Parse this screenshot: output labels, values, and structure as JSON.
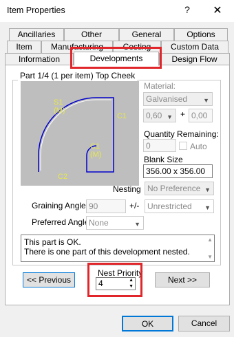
{
  "window": {
    "title": "Item Properties",
    "help": "?",
    "close": "✕"
  },
  "tabs_row1": [
    "Ancillaries",
    "Other",
    "General",
    "Options"
  ],
  "tabs_row2": [
    "Item",
    "Manufacturing",
    "Costing",
    "Custom Data"
  ],
  "tabs_row3": [
    "Information",
    "Developments",
    "Design Flow"
  ],
  "group": {
    "title": "Part 1/4 (1 per item) Top Cheek"
  },
  "preview": {
    "s1": "S1",
    "s1m": "(M)",
    "c1_right": "C1",
    "c1_inner": "C1",
    "c1_inner_m": "(M)",
    "c2": "C2"
  },
  "material": {
    "label": "Material:",
    "value": "Galvanised",
    "gauge": "0,60",
    "plus": "+",
    "extra": "0,00"
  },
  "quantity": {
    "label": "Quantity Remaining:",
    "value": "0",
    "auto_label": "Auto"
  },
  "blank": {
    "label": "Blank Size",
    "value": "356.00 x 356.00"
  },
  "nesting": {
    "label": "Nesting",
    "value": "No Preference",
    "restriction": "Unrestricted",
    "plus_minus": "+/-"
  },
  "graining": {
    "label": "Graining Angle",
    "value": "90"
  },
  "preferred": {
    "label": "Preferred Angle",
    "value": "None"
  },
  "message": {
    "line1": "This part is OK.",
    "line2": "There is one part of this development nested."
  },
  "nav": {
    "previous": "<< Previous",
    "next": "Next >>"
  },
  "nest_priority": {
    "label": "Nest Priority",
    "value": "4"
  },
  "footer": {
    "ok": "OK",
    "cancel": "Cancel"
  },
  "colors": {
    "highlight": "#e0262a",
    "shape": "#0000cc",
    "preview_bg": "#bebebe",
    "label_yellow": "#e8e84a"
  }
}
